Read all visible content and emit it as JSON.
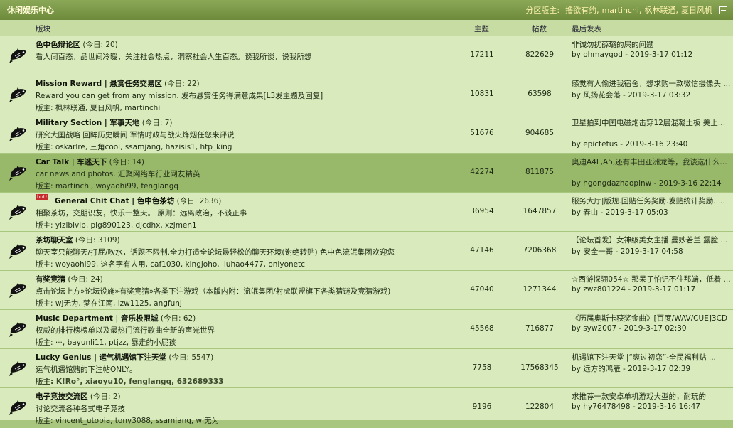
{
  "category": {
    "title": "休闲娱乐中心",
    "moderators_label": "分区版主:",
    "moderators": [
      "撸欲有约,",
      "martinchi,",
      "枫林联通,",
      "夏日风帆"
    ]
  },
  "columns": {
    "board": "版块",
    "topics": "主题",
    "posts": "帖数",
    "last_post": "最后发表"
  },
  "forums": [
    {
      "name": "色中色辩论区",
      "today": "(今日: 20)",
      "desc": "看人间百态，品世间冷暖，关注社会热点，洞察社会人生百态。谈我所谈，说我所想",
      "mods": "",
      "topics": "17211",
      "posts": "822629",
      "last_title": "非诚勿扰薛璐的屄的问题",
      "last_by": "by ohmaygod - 2019-3-17 01:12"
    },
    {
      "name": "Mission Reward | 悬赏任务交易区",
      "today": "(今日: 22)",
      "desc": "Reward you can get from any mission. 发布悬赏任务得满意成果[L3发主题及回复]",
      "mods": "版主: 枫林联通, 夏日风帆, martinchi",
      "topics": "10831",
      "posts": "63598",
      "last_title": "感觉有人偷进我宿舍，想求购一款微信摄像头 ...",
      "last_by": "by 风扬花会落 - 2019-3-17 03:32"
    },
    {
      "name": "Military Section | 军事天地",
      "today": "(今日: 7)",
      "desc": "研究大国战略 回眸历史瞬间 军情时政与战火烽烟任您来评说",
      "mods": "版主: oskarlre, 三角cool, ssamjang, hazisis1, htp_king",
      "topics": "51676",
      "posts": "904685",
      "last_title": "卫星拍到中国电磁炮击穿12层混凝土板 美上将 ...",
      "last_by": "by epictetus - 2019-3-16 23:40"
    },
    {
      "name": "Car Talk | 车迷天下",
      "today": "(今日: 14)",
      "desc": "car news and photos. 汇聚网络车行业网友精英",
      "mods": "版主: martinchi, woyaohi99, fenglangq",
      "topics": "42274",
      "posts": "811875",
      "last_title": "奥迪A4L,A5,还有丰田亚洲龙等，我该选什么？ ...",
      "last_by": "by hgongdazhaopinw - 2019-3-16 22:14"
    },
    {
      "badge": "hot",
      "name": "General Chit Chat | 色中色茶坊",
      "today": "(今日: 2636)",
      "desc": "相聚茶坊，交朋识友，快乐一整天。 原则：远离政治，不谈正事",
      "mods": "版主: yizibivip, pig890123, djcdhx, xzjmen1",
      "topics": "36954",
      "posts": "1647857",
      "last_title": "服务大厅|版规.回贴任务奖励.发贴统计奖励. ...",
      "last_by": "by 春山 - 2019-3-17 05:03"
    },
    {
      "name": "茶坊聊天室",
      "today": "(今日: 3109)",
      "desc": "聊天室只能聊天/打屁/吹水，话题不限制.全力打造全论坛最轻松的聊天环境(谢绝转贴) 色中色流氓集团欢迎您",
      "mods": "版主: woyaohi99, 这名字有人用, caf1030, kingjoho, liuhao4477, onlyonetc",
      "topics": "47146",
      "posts": "7206368",
      "last_title": "【论坛首发】女神级美女主播 曼妙若兰 露脸 ...",
      "last_by": "by 安全一哥 - 2019-3-17 04:58"
    },
    {
      "name": "有奖竞猜",
      "today": "(今日: 24)",
      "desc": "点击论坛上方»论坛设施»有奖竞猜»各类下注游戏（本版内附：流氓集团/射虎联盟旗下各类猜谜及竞猜游戏)",
      "mods": "版主: wj无为, 梦在江南, lzw1125, angfunj",
      "topics": "47040",
      "posts": "1271344",
      "last_title": "☆西游探骊054☆ 那呆子怕记不住那端，低着 ...",
      "last_by": "by zwz801224 - 2019-3-17 01:17"
    },
    {
      "name": "Music Department | 音乐极限城",
      "today": "(今日: 62)",
      "desc": "权威的排行榜榜单以及最热门流行歌曲全新的声光世界",
      "mods": "版主: ···, bayunli11, ptjzz, 暴走的小屁孩",
      "topics": "45568",
      "posts": "716877",
      "last_title": "《历届奥斯卡获奖金曲》[百度/WAV/CUE]3CD",
      "last_by": "by syw2007 - 2019-3-17 02:30"
    },
    {
      "name": "Lucky Genius | 运气机遇馆下注天堂",
      "today": "(今日: 5547)",
      "desc": "运气机遇馆赌的下注帖ONLY。",
      "mods": "版主: K!Ro°, xiaoyu10, fenglangq, 632689333",
      "mods_bold": true,
      "topics": "7758",
      "posts": "17568345",
      "last_title": "机遇馆下注天堂 |“爽过初恋”-全民福利贴 ...",
      "last_by": "by 远方的鸿雁 - 2019-3-17 02:39"
    },
    {
      "name": "电子竞技交流区",
      "today": "(今日: 2)",
      "desc": "讨论交流各种各式电子竞技",
      "mods": "版主: vincent_utopia, tony3088, ssamjang, wj无为",
      "topics": "9196",
      "posts": "122804",
      "last_title": "求推荐一款安卓单机游戏大型的，耐玩的",
      "last_by": "by hy76478498 - 2019-3-16 16:47"
    }
  ],
  "highlighted_row": 3,
  "colors": {
    "header_bg": "#7c9a48",
    "row_bg": "#d9ebbd",
    "row_highlight": "#98b86a"
  },
  "icons": {
    "forum": "fish-icon",
    "collapse": "collapse-icon",
    "hot_badge": "hot-badge-icon"
  }
}
